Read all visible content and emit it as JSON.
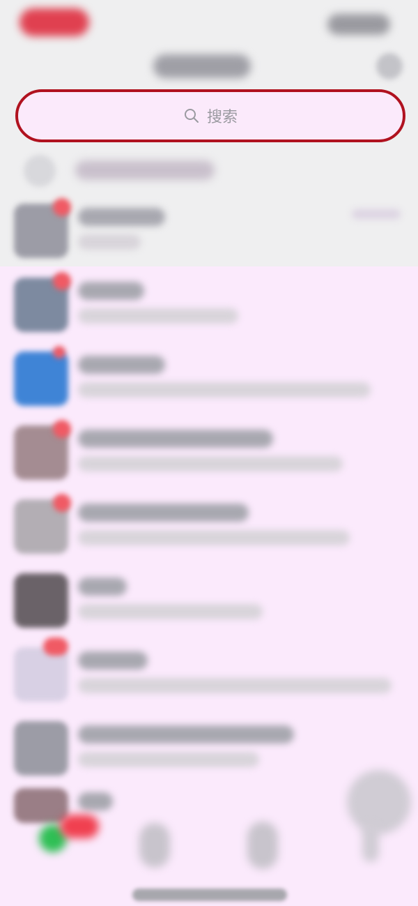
{
  "search": {
    "placeholder": "搜索"
  },
  "colors": {
    "search_border": "#b0121f",
    "page_background": "#fbeafc",
    "top_background": "#efeff0"
  }
}
